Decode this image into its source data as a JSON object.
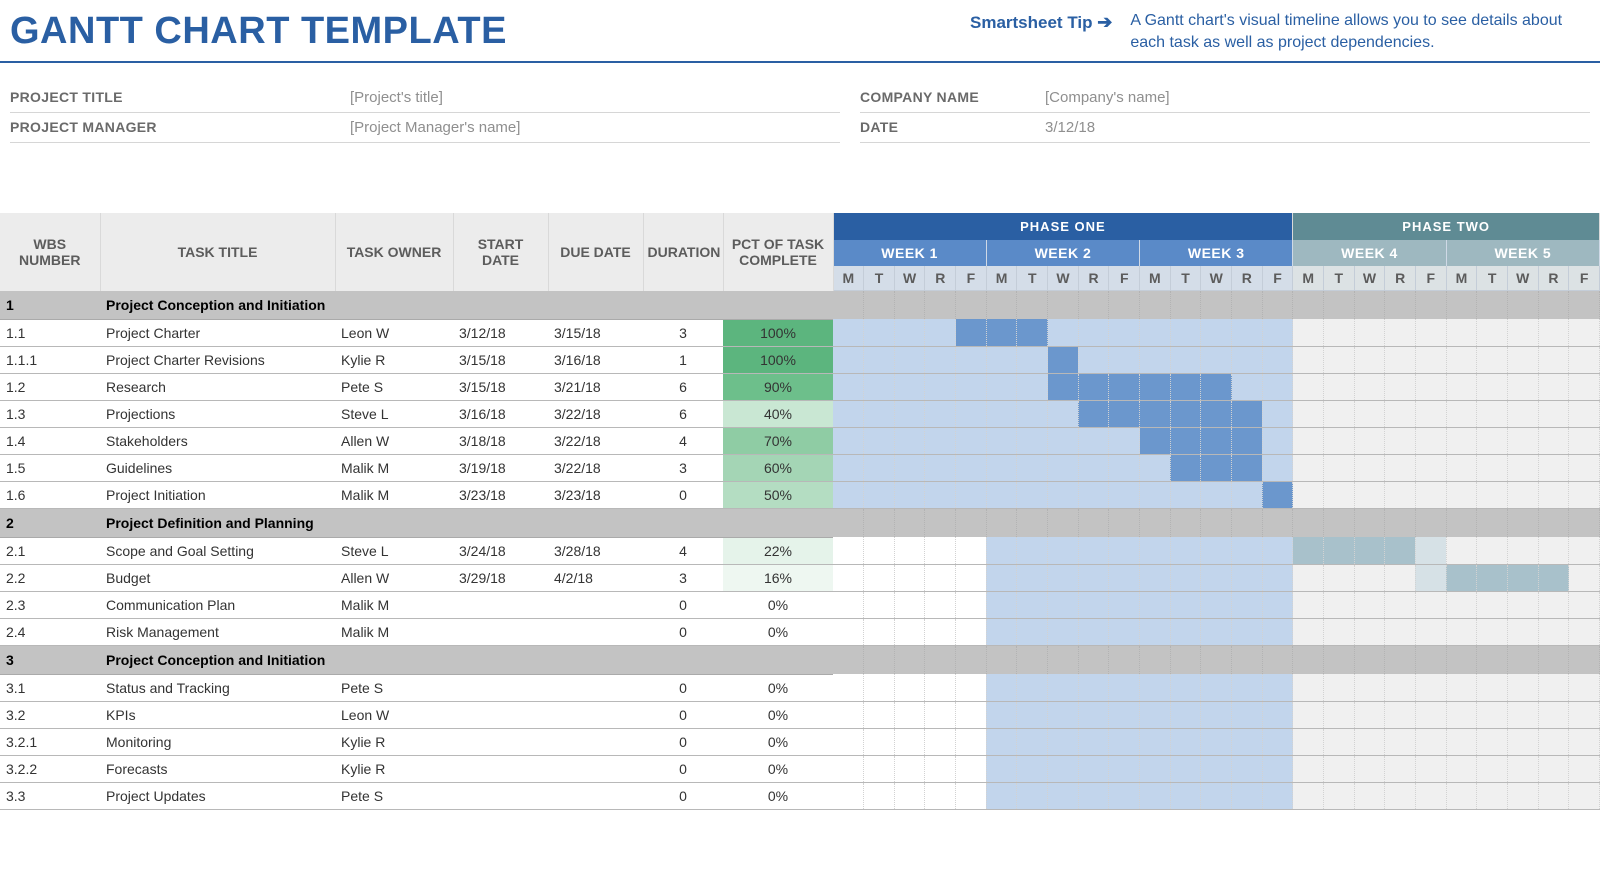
{
  "header": {
    "title": "GANTT CHART TEMPLATE",
    "tip_link": "Smartsheet Tip",
    "tip_text": "A Gantt chart's visual timeline allows you to see details about each task as well as project dependencies."
  },
  "meta": {
    "project_title_label": "PROJECT TITLE",
    "project_title_value": "[Project's title]",
    "project_manager_label": "PROJECT MANAGER",
    "project_manager_value": "[Project Manager's name]",
    "company_label": "COMPANY NAME",
    "company_value": "[Company's name]",
    "date_label": "DATE",
    "date_value": "3/12/18"
  },
  "columns": {
    "wbs": "WBS NUMBER",
    "title": "TASK TITLE",
    "owner": "TASK OWNER",
    "start": "START DATE",
    "due": "DUE DATE",
    "duration": "DURATION",
    "pct": "PCT OF TASK COMPLETE"
  },
  "phases": [
    "PHASE ONE",
    "PHASE TWO"
  ],
  "weeks": [
    "WEEK 1",
    "WEEK 2",
    "WEEK 3",
    "WEEK 4",
    "WEEK 5"
  ],
  "days": [
    "M",
    "T",
    "W",
    "R",
    "F"
  ],
  "rows": [
    {
      "type": "section",
      "wbs": "1",
      "title": "Project Conception and Initiation"
    },
    {
      "type": "task",
      "wbs": "1.1",
      "title": "Project Charter",
      "owner": "Leon W",
      "start": "3/12/18",
      "due": "3/15/18",
      "duration": "3",
      "pct": "100%",
      "pctClass": "pct-100",
      "bar": [
        4,
        5,
        6
      ],
      "barClass": "bar1",
      "light": [
        0,
        1,
        2,
        3,
        7,
        8,
        9,
        10,
        11,
        12,
        13,
        14
      ]
    },
    {
      "type": "task",
      "wbs": "1.1.1",
      "title": "Project Charter Revisions",
      "owner": "Kylie R",
      "start": "3/15/18",
      "due": "3/16/18",
      "duration": "1",
      "pct": "100%",
      "pctClass": "pct-100",
      "bar": [
        7
      ],
      "barClass": "bar1",
      "light": [
        0,
        1,
        2,
        3,
        4,
        5,
        6,
        8,
        9,
        10,
        11,
        12,
        13,
        14
      ]
    },
    {
      "type": "task",
      "wbs": "1.2",
      "title": "Research",
      "owner": "Pete S",
      "start": "3/15/18",
      "due": "3/21/18",
      "duration": "6",
      "pct": "90%",
      "pctClass": "pct-90",
      "bar": [
        7,
        8,
        9,
        10,
        11,
        12
      ],
      "barClass": "bar1",
      "light": [
        0,
        1,
        2,
        3,
        4,
        5,
        6,
        13,
        14
      ]
    },
    {
      "type": "task",
      "wbs": "1.3",
      "title": "Projections",
      "owner": "Steve L",
      "start": "3/16/18",
      "due": "3/22/18",
      "duration": "6",
      "pct": "40%",
      "pctClass": "pct-40",
      "bar": [
        8,
        9,
        10,
        11,
        12,
        13
      ],
      "barClass": "bar1",
      "light": [
        0,
        1,
        2,
        3,
        4,
        5,
        6,
        7,
        14
      ]
    },
    {
      "type": "task",
      "wbs": "1.4",
      "title": "Stakeholders",
      "owner": "Allen W",
      "start": "3/18/18",
      "due": "3/22/18",
      "duration": "4",
      "pct": "70%",
      "pctClass": "pct-70",
      "bar": [
        10,
        11,
        12,
        13
      ],
      "barClass": "bar1",
      "light": [
        0,
        1,
        2,
        3,
        4,
        5,
        6,
        7,
        8,
        9,
        14
      ]
    },
    {
      "type": "task",
      "wbs": "1.5",
      "title": "Guidelines",
      "owner": "Malik M",
      "start": "3/19/18",
      "due": "3/22/18",
      "duration": "3",
      "pct": "60%",
      "pctClass": "pct-60",
      "bar": [
        11,
        12,
        13
      ],
      "barClass": "bar1",
      "light": [
        0,
        1,
        2,
        3,
        4,
        5,
        6,
        7,
        8,
        9,
        10,
        14
      ]
    },
    {
      "type": "task",
      "wbs": "1.6",
      "title": "Project Initiation",
      "owner": "Malik M",
      "start": "3/23/18",
      "due": "3/23/18",
      "duration": "0",
      "pct": "50%",
      "pctClass": "pct-50",
      "bar": [
        14
      ],
      "barClass": "bar1",
      "light": [
        0,
        1,
        2,
        3,
        4,
        5,
        6,
        7,
        8,
        9,
        10,
        11,
        12,
        13
      ]
    },
    {
      "type": "section",
      "wbs": "2",
      "title": "Project Definition and Planning"
    },
    {
      "type": "task",
      "wbs": "2.1",
      "title": "Scope and Goal Setting",
      "owner": "Steve L",
      "start": "3/24/18",
      "due": "3/28/18",
      "duration": "4",
      "pct": "22%",
      "pctClass": "pct-22",
      "bar": [
        15,
        16,
        17,
        18
      ],
      "barClass": "bar2",
      "light": [
        5,
        6,
        7,
        8,
        9,
        10,
        11,
        12,
        13,
        14,
        19
      ]
    },
    {
      "type": "task",
      "wbs": "2.2",
      "title": "Budget",
      "owner": "Allen W",
      "start": "3/29/18",
      "due": "4/2/18",
      "duration": "3",
      "pct": "16%",
      "pctClass": "pct-16",
      "bar": [
        20,
        21,
        22,
        23
      ],
      "barClass": "bar2",
      "light": [
        5,
        6,
        7,
        8,
        9,
        10,
        11,
        12,
        13,
        14,
        19
      ]
    },
    {
      "type": "task",
      "wbs": "2.3",
      "title": "Communication Plan",
      "owner": "Malik M",
      "start": "",
      "due": "",
      "duration": "0",
      "pct": "0%",
      "pctClass": "pct-0",
      "bar": [],
      "barClass": "",
      "light": [
        5,
        6,
        7,
        8,
        9,
        10,
        11,
        12,
        13,
        14
      ]
    },
    {
      "type": "task",
      "wbs": "2.4",
      "title": "Risk Management",
      "owner": "Malik M",
      "start": "",
      "due": "",
      "duration": "0",
      "pct": "0%",
      "pctClass": "pct-0",
      "bar": [],
      "barClass": "",
      "light": [
        5,
        6,
        7,
        8,
        9,
        10,
        11,
        12,
        13,
        14
      ]
    },
    {
      "type": "section",
      "wbs": "3",
      "title": "Project Conception and Initiation"
    },
    {
      "type": "task",
      "wbs": "3.1",
      "title": "Status and Tracking",
      "owner": "Pete S",
      "start": "",
      "due": "",
      "duration": "0",
      "pct": "0%",
      "pctClass": "pct-0",
      "bar": [],
      "barClass": "",
      "light": [
        5,
        6,
        7,
        8,
        9,
        10,
        11,
        12,
        13,
        14
      ]
    },
    {
      "type": "task",
      "wbs": "3.2",
      "title": "KPIs",
      "owner": "Leon W",
      "start": "",
      "due": "",
      "duration": "0",
      "pct": "0%",
      "pctClass": "pct-0",
      "bar": [],
      "barClass": "",
      "light": [
        5,
        6,
        7,
        8,
        9,
        10,
        11,
        12,
        13,
        14
      ]
    },
    {
      "type": "task",
      "wbs": "3.2.1",
      "title": "Monitoring",
      "owner": "Kylie R",
      "start": "",
      "due": "",
      "duration": "0",
      "pct": "0%",
      "pctClass": "pct-0",
      "bar": [],
      "barClass": "",
      "light": [
        5,
        6,
        7,
        8,
        9,
        10,
        11,
        12,
        13,
        14
      ]
    },
    {
      "type": "task",
      "wbs": "3.2.2",
      "title": "Forecasts",
      "owner": "Kylie R",
      "start": "",
      "due": "",
      "duration": "0",
      "pct": "0%",
      "pctClass": "pct-0",
      "bar": [],
      "barClass": "",
      "light": [
        5,
        6,
        7,
        8,
        9,
        10,
        11,
        12,
        13,
        14
      ]
    },
    {
      "type": "task",
      "wbs": "3.3",
      "title": "Project Updates",
      "owner": "Pete S",
      "start": "",
      "due": "",
      "duration": "0",
      "pct": "0%",
      "pctClass": "pct-0",
      "bar": [],
      "barClass": "",
      "light": [
        5,
        6,
        7,
        8,
        9,
        10,
        11,
        12,
        13,
        14
      ]
    }
  ],
  "chart_data": {
    "type": "gantt",
    "title": "GANTT CHART TEMPLATE",
    "start_date": "3/12/18",
    "phases": [
      {
        "name": "PHASE ONE",
        "weeks": [
          "WEEK 1",
          "WEEK 2",
          "WEEK 3"
        ]
      },
      {
        "name": "PHASE TWO",
        "weeks": [
          "WEEK 4",
          "WEEK 5"
        ]
      }
    ],
    "day_labels": [
      "M",
      "T",
      "W",
      "R",
      "F"
    ],
    "tasks": [
      {
        "wbs": "1",
        "title": "Project Conception and Initiation",
        "section": true
      },
      {
        "wbs": "1.1",
        "title": "Project Charter",
        "owner": "Leon W",
        "start": "3/12/18",
        "due": "3/15/18",
        "duration": 3,
        "pct_complete": 100
      },
      {
        "wbs": "1.1.1",
        "title": "Project Charter Revisions",
        "owner": "Kylie R",
        "start": "3/15/18",
        "due": "3/16/18",
        "duration": 1,
        "pct_complete": 100
      },
      {
        "wbs": "1.2",
        "title": "Research",
        "owner": "Pete S",
        "start": "3/15/18",
        "due": "3/21/18",
        "duration": 6,
        "pct_complete": 90
      },
      {
        "wbs": "1.3",
        "title": "Projections",
        "owner": "Steve L",
        "start": "3/16/18",
        "due": "3/22/18",
        "duration": 6,
        "pct_complete": 40
      },
      {
        "wbs": "1.4",
        "title": "Stakeholders",
        "owner": "Allen W",
        "start": "3/18/18",
        "due": "3/22/18",
        "duration": 4,
        "pct_complete": 70
      },
      {
        "wbs": "1.5",
        "title": "Guidelines",
        "owner": "Malik M",
        "start": "3/19/18",
        "due": "3/22/18",
        "duration": 3,
        "pct_complete": 60
      },
      {
        "wbs": "1.6",
        "title": "Project Initiation",
        "owner": "Malik M",
        "start": "3/23/18",
        "due": "3/23/18",
        "duration": 0,
        "pct_complete": 50
      },
      {
        "wbs": "2",
        "title": "Project Definition and Planning",
        "section": true
      },
      {
        "wbs": "2.1",
        "title": "Scope and Goal Setting",
        "owner": "Steve L",
        "start": "3/24/18",
        "due": "3/28/18",
        "duration": 4,
        "pct_complete": 22
      },
      {
        "wbs": "2.2",
        "title": "Budget",
        "owner": "Allen W",
        "start": "3/29/18",
        "due": "4/2/18",
        "duration": 3,
        "pct_complete": 16
      },
      {
        "wbs": "2.3",
        "title": "Communication Plan",
        "owner": "Malik M",
        "start": "",
        "due": "",
        "duration": 0,
        "pct_complete": 0
      },
      {
        "wbs": "2.4",
        "title": "Risk Management",
        "owner": "Malik M",
        "start": "",
        "due": "",
        "duration": 0,
        "pct_complete": 0
      },
      {
        "wbs": "3",
        "title": "Project Conception and Initiation",
        "section": true
      },
      {
        "wbs": "3.1",
        "title": "Status and Tracking",
        "owner": "Pete S",
        "start": "",
        "due": "",
        "duration": 0,
        "pct_complete": 0
      },
      {
        "wbs": "3.2",
        "title": "KPIs",
        "owner": "Leon W",
        "start": "",
        "due": "",
        "duration": 0,
        "pct_complete": 0
      },
      {
        "wbs": "3.2.1",
        "title": "Monitoring",
        "owner": "Kylie R",
        "start": "",
        "due": "",
        "duration": 0,
        "pct_complete": 0
      },
      {
        "wbs": "3.2.2",
        "title": "Forecasts",
        "owner": "Kylie R",
        "start": "",
        "due": "",
        "duration": 0,
        "pct_complete": 0
      },
      {
        "wbs": "3.3",
        "title": "Project Updates",
        "owner": "Pete S",
        "start": "",
        "due": "",
        "duration": 0,
        "pct_complete": 0
      }
    ]
  }
}
